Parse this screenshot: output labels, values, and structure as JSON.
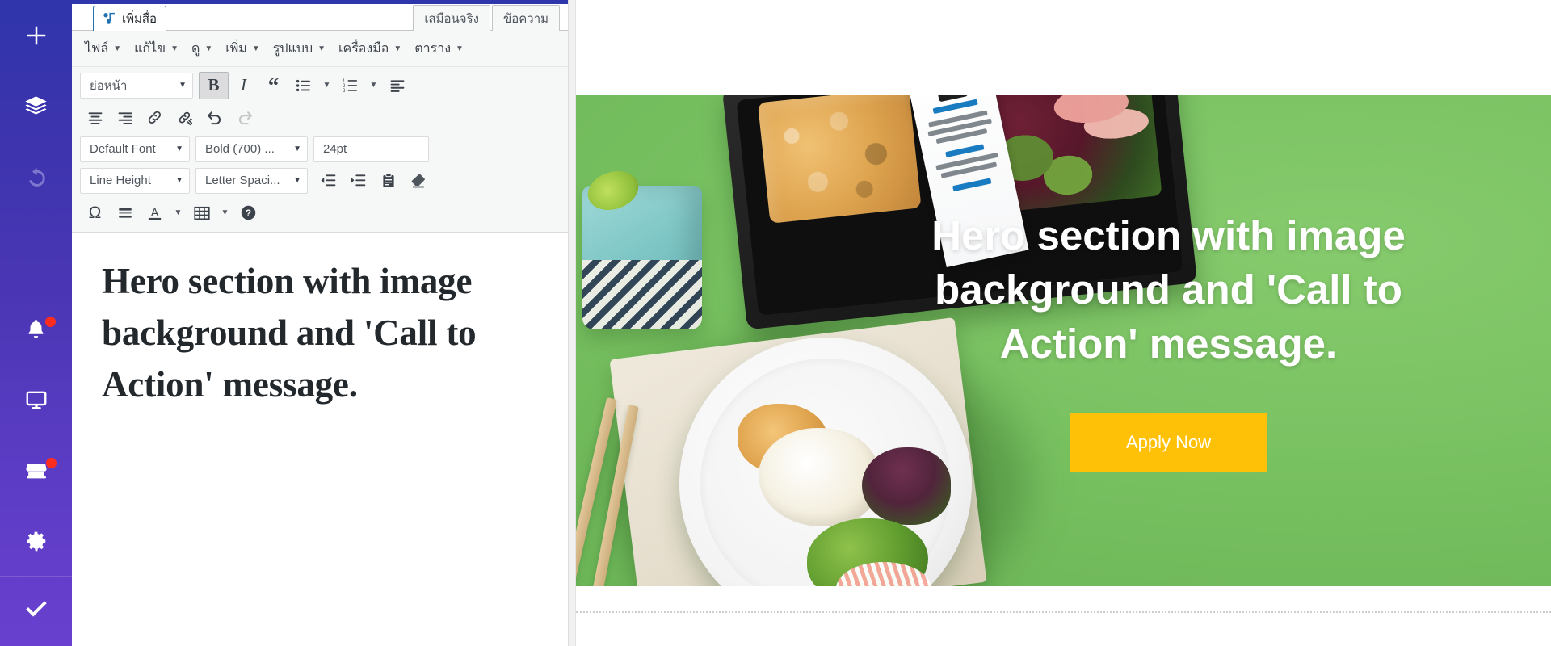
{
  "sidebar": {
    "items": [
      {
        "name": "add",
        "icon": "plus-icon",
        "badge": false,
        "dim": false
      },
      {
        "name": "layers",
        "icon": "layers-icon",
        "badge": false,
        "dim": false
      },
      {
        "name": "undo",
        "icon": "undo-icon",
        "badge": false,
        "dim": true
      },
      {
        "name": "notifications",
        "icon": "bell-icon",
        "badge": true,
        "dim": false
      },
      {
        "name": "preview",
        "icon": "monitor-icon",
        "badge": false,
        "dim": false
      },
      {
        "name": "store",
        "icon": "store-icon",
        "badge": true,
        "dim": false
      },
      {
        "name": "settings",
        "icon": "gear-icon",
        "badge": false,
        "dim": false
      }
    ],
    "bottom": {
      "name": "publish",
      "icon": "check-icon"
    },
    "gradient_from": "#2f35ab",
    "gradient_to": "#6940cf",
    "badge_color": "#ff2d20"
  },
  "editor": {
    "add_media_label": "เพิ่มสื่อ",
    "add_media_icon": "media-icon",
    "tabs": [
      {
        "id": "visual",
        "label": "เสมือนจริง",
        "active": false
      },
      {
        "id": "text",
        "label": "ข้อความ",
        "active": false
      }
    ],
    "menubar": [
      {
        "label": "ไฟล์"
      },
      {
        "label": "แก้ไข"
      },
      {
        "label": "ดู"
      },
      {
        "label": "เพิ่ม"
      },
      {
        "label": "รูปแบบ"
      },
      {
        "label": "เครื่องมือ"
      },
      {
        "label": "ตาราง"
      }
    ],
    "caret_glyph": "▼",
    "toolbar_row1": {
      "paragraph_select": "ย่อหน้า",
      "buttons": [
        {
          "name": "bold-button",
          "glyph": "B",
          "active": true
        },
        {
          "name": "italic-button",
          "glyph": "I",
          "active": false
        },
        {
          "name": "blockquote-button",
          "glyph": "“",
          "active": false
        },
        {
          "name": "bullet-list-button",
          "glyph": "bullet-list-icon",
          "active": false
        },
        {
          "name": "numbered-list-button",
          "glyph": "numbered-list-icon",
          "active": false
        },
        {
          "name": "align-left-button",
          "glyph": "align-left-icon",
          "active": false
        }
      ]
    },
    "toolbar_row2": {
      "buttons": [
        {
          "name": "align-center-button",
          "glyph": "align-center-icon"
        },
        {
          "name": "align-right-button",
          "glyph": "align-right-icon"
        },
        {
          "name": "insert-link-button",
          "glyph": "link-icon"
        },
        {
          "name": "remove-link-button",
          "glyph": "unlink-icon"
        },
        {
          "name": "undo-button",
          "glyph": "undo-icon"
        },
        {
          "name": "redo-button",
          "glyph": "redo-icon",
          "disabled": true
        }
      ]
    },
    "toolbar_row3": {
      "font_select": "Default Font",
      "weight_select": "Bold (700) ...",
      "size_select": "24pt"
    },
    "toolbar_row4": {
      "line_height_select": "Line Height",
      "letter_spacing_select": "Letter Spaci...",
      "buttons": [
        {
          "name": "decrease-indent-button",
          "glyph": "outdent-icon"
        },
        {
          "name": "increase-indent-button",
          "glyph": "indent-icon"
        },
        {
          "name": "paste-as-text-button",
          "glyph": "clipboard-icon"
        },
        {
          "name": "clear-formatting-button",
          "glyph": "eraser-icon"
        }
      ]
    },
    "toolbar_row5": {
      "buttons": [
        {
          "name": "special-character-button",
          "glyph": "Ω"
        },
        {
          "name": "horizontal-rule-button",
          "glyph": "hr-icon"
        },
        {
          "name": "text-color-button",
          "glyph": "A"
        },
        {
          "name": "table-button",
          "glyph": "table-icon"
        },
        {
          "name": "keyboard-shortcuts-button",
          "glyph": "help-icon"
        }
      ]
    },
    "content": "Hero section with image background and 'Call to Action' message."
  },
  "preview": {
    "hero": {
      "title": "Hero section with image background and 'Call to Action' message.",
      "cta_label": "Apply Now",
      "cta_color": "#ffc107",
      "cta_text_color": "#ffffff",
      "background_color": "#74bd5f",
      "title_color": "#ffffff",
      "background_image": "food-photo-green-background"
    }
  }
}
